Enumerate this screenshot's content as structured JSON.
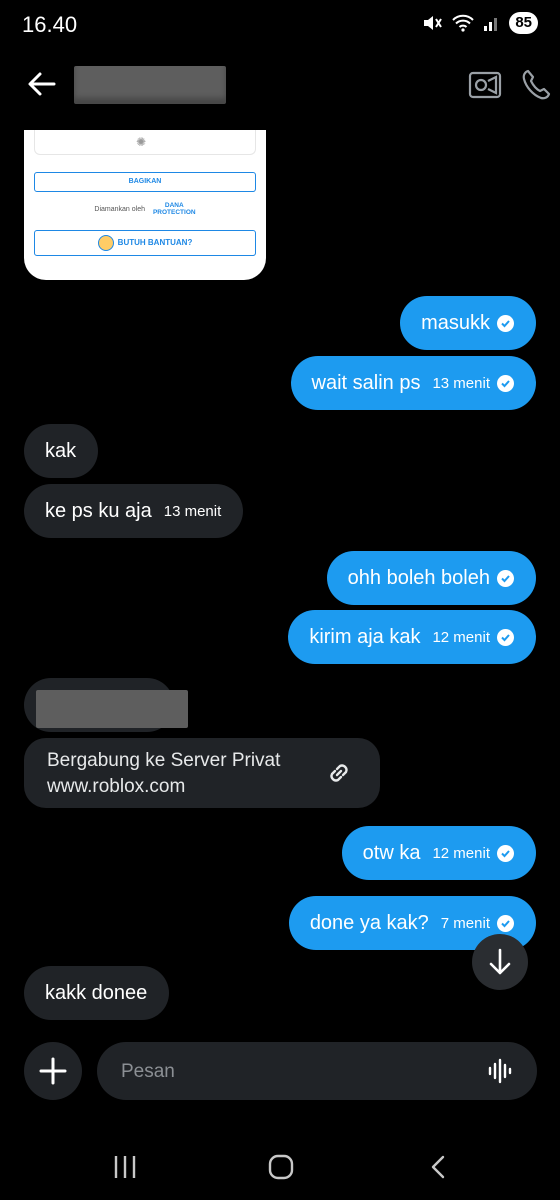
{
  "status": {
    "time": "16.40",
    "battery": "85"
  },
  "card": {
    "share_label": "BAGIKAN",
    "secured_by": "Diamankan oleh",
    "brand_line1": "DANA",
    "brand_line2": "PROTECTION",
    "help_label": "BUTUH BANTUAN?"
  },
  "messages": [
    {
      "text": "masukk",
      "time": "",
      "dir": "out"
    },
    {
      "text": "wait salin ps",
      "time": "13 menit",
      "dir": "out"
    },
    {
      "text": "kak",
      "time": "",
      "dir": "in"
    },
    {
      "text": "ke ps ku aja",
      "time": "13 menit",
      "dir": "in"
    },
    {
      "text": "ohh boleh boleh",
      "time": "",
      "dir": "out"
    },
    {
      "text": "kirim aja kak",
      "time": "12 menit",
      "dir": "out"
    },
    {
      "text": "otw ka",
      "time": "12 menit",
      "dir": "out"
    },
    {
      "text": "done ya kak?",
      "time": "7 menit",
      "dir": "out"
    },
    {
      "text": "kakk donee",
      "time": "",
      "dir": "in"
    }
  ],
  "link_preview": {
    "title": "Bergabung ke Server Privat",
    "domain": "www.roblox.com"
  },
  "composer": {
    "placeholder": "Pesan"
  },
  "colors": {
    "outgoing": "#1d9bf0",
    "incoming": "#202327",
    "background": "#000000"
  }
}
